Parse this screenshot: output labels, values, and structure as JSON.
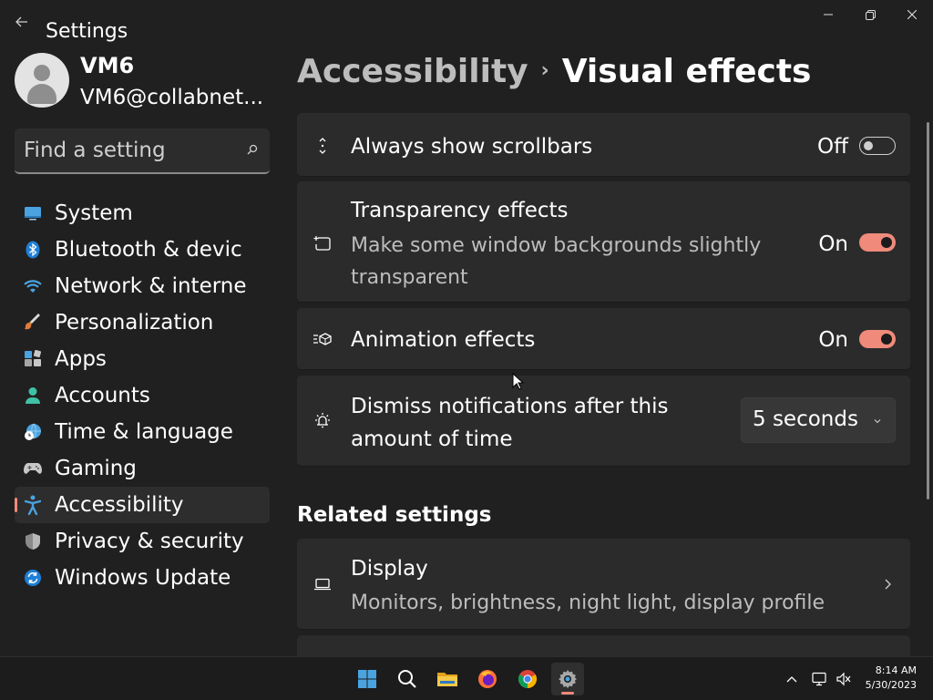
{
  "window": {
    "app_title": "Settings"
  },
  "user": {
    "name": "VM6",
    "email": "VM6@collabnet..."
  },
  "search": {
    "placeholder": "Find a setting"
  },
  "nav": [
    {
      "label": "System",
      "icon": "system-icon",
      "active": false
    },
    {
      "label": "Bluetooth & devic",
      "icon": "bluetooth-icon",
      "active": false
    },
    {
      "label": "Network & interne",
      "icon": "wifi-icon",
      "active": false
    },
    {
      "label": "Personalization",
      "icon": "brush-icon",
      "active": false
    },
    {
      "label": "Apps",
      "icon": "apps-icon",
      "active": false
    },
    {
      "label": "Accounts",
      "icon": "accounts-icon",
      "active": false
    },
    {
      "label": "Time & language",
      "icon": "globe-clock-icon",
      "active": false
    },
    {
      "label": "Gaming",
      "icon": "gamepad-icon",
      "active": false
    },
    {
      "label": "Accessibility",
      "icon": "accessibility-icon",
      "active": true
    },
    {
      "label": "Privacy & security",
      "icon": "shield-icon",
      "active": false
    },
    {
      "label": "Windows Update",
      "icon": "update-icon",
      "active": false
    }
  ],
  "header": {
    "parent": "Accessibility",
    "current": "Visual effects"
  },
  "settings": {
    "scrollbars": {
      "title": "Always show scrollbars",
      "state": "Off",
      "enabled": false
    },
    "transparency": {
      "title": "Transparency effects",
      "subtitle": "Make some window backgrounds slightly transparent",
      "state": "On",
      "enabled": true
    },
    "animation": {
      "title": "Animation effects",
      "state": "On",
      "enabled": true
    },
    "dismiss": {
      "title": "Dismiss notifications after this amount of time",
      "value": "5 seconds"
    }
  },
  "related": {
    "heading": "Related settings",
    "display": {
      "title": "Display",
      "subtitle": "Monitors, brightness, night light, display profile"
    }
  },
  "taskbar": {
    "apps": [
      "start-icon",
      "search-icon",
      "file-explorer-icon",
      "firefox-icon",
      "chrome-icon",
      "settings-icon"
    ],
    "active_app": "settings-icon",
    "time": "8:14 AM",
    "date": "5/30/2023"
  },
  "colors": {
    "accent": "#f08a7a",
    "background": "#202020",
    "card": "#2b2b2b"
  }
}
